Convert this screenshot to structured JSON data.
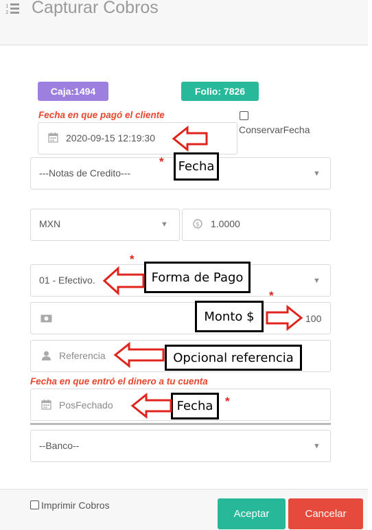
{
  "header": {
    "title": "Capturar Cobros",
    "menu_icon": "list-numbered-icon"
  },
  "badges": {
    "caja": "Caja:1494",
    "folio": "Folio: 7826"
  },
  "fecha_cliente": {
    "label": "Fecha en que pagó el cliente",
    "value": "2020-09-15 12:19:30",
    "icon": "calendar-icon"
  },
  "conservar_fecha": {
    "label": "ConservarFecha",
    "checked": false
  },
  "notas_credito": {
    "value": "---Notas de Credito---"
  },
  "moneda": {
    "value": "MXN"
  },
  "tipo_cambio": {
    "value": "1.0000",
    "icon": "dollar-coin-icon"
  },
  "forma_pago": {
    "value": "01 - Efectivo."
  },
  "monto": {
    "value": "100",
    "icon": "money-bill-icon"
  },
  "referencia": {
    "placeholder": "Referencia",
    "icon": "user-icon"
  },
  "fecha_cuenta": {
    "label": "Fecha en que entró el dinero a tu cuenta",
    "placeholder": "PosFechado",
    "icon": "calendar-icon"
  },
  "banco": {
    "value": "--Banco--"
  },
  "annotations": {
    "star": "*",
    "fecha_1": "Fecha",
    "forma_pago": "Forma de Pago",
    "monto": "Monto $",
    "referencia": "Opcional referencia",
    "fecha_2": "Fecha"
  },
  "footer": {
    "imprimir_label": "Imprimir Cobros",
    "imprimir_checked": false,
    "aceptar": "Aceptar",
    "cancelar": "Cancelar"
  },
  "colors": {
    "caja_badge": "#9d7fe0",
    "folio_badge": "#27b99a",
    "label_red": "#e8462e",
    "aceptar": "#26b899",
    "cancelar": "#e64a3c"
  }
}
